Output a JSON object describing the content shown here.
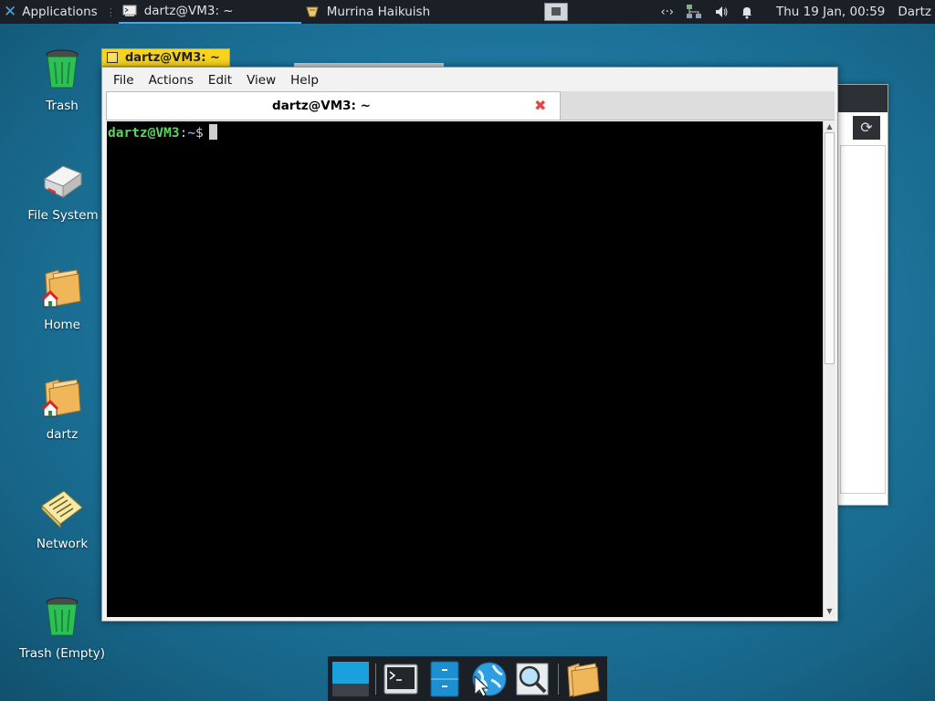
{
  "top_panel": {
    "applications_label": "Applications",
    "tasks": [
      {
        "label": "dartz@VM3: ~",
        "icon": "terminal-icon"
      },
      {
        "label": "Murrina Haikuish",
        "icon": "theme-icon"
      }
    ],
    "clock": "Thu 19 Jan, 00:59",
    "user": "Dartz",
    "tray_icons": [
      "network-arrows-icon",
      "network-icon",
      "volume-icon",
      "notification-bell-icon"
    ]
  },
  "desktop": {
    "icons": [
      {
        "label": "Trash",
        "icon": "trash-icon"
      },
      {
        "label": "File System",
        "icon": "drive-icon"
      },
      {
        "label": "Home",
        "icon": "home-folder-icon"
      },
      {
        "label": "dartz",
        "icon": "home-folder-icon"
      },
      {
        "label": "Network",
        "icon": "network-folder-icon"
      },
      {
        "label": "Trash (Empty)",
        "icon": "trash-icon"
      }
    ]
  },
  "terminal": {
    "window_title": "dartz@VM3: ~",
    "menu": [
      "File",
      "Actions",
      "Edit",
      "View",
      "Help"
    ],
    "tab_title": "dartz@VM3: ~",
    "prompt_user": "dartz@VM3",
    "prompt_sep": ":",
    "prompt_path": "~",
    "prompt_symbol": "$"
  },
  "dock": {
    "items": [
      "show-desktop-icon",
      "terminal-icon",
      "file-manager-icon",
      "web-browser-icon",
      "search-icon",
      "folder-icon"
    ]
  },
  "colors": {
    "panel_bg": "#1b2026",
    "accent": "#4ea3e0",
    "title_tab": "#f7d21e",
    "prompt_user": "#5fd35f",
    "prompt_path": "#7aa6e6"
  }
}
